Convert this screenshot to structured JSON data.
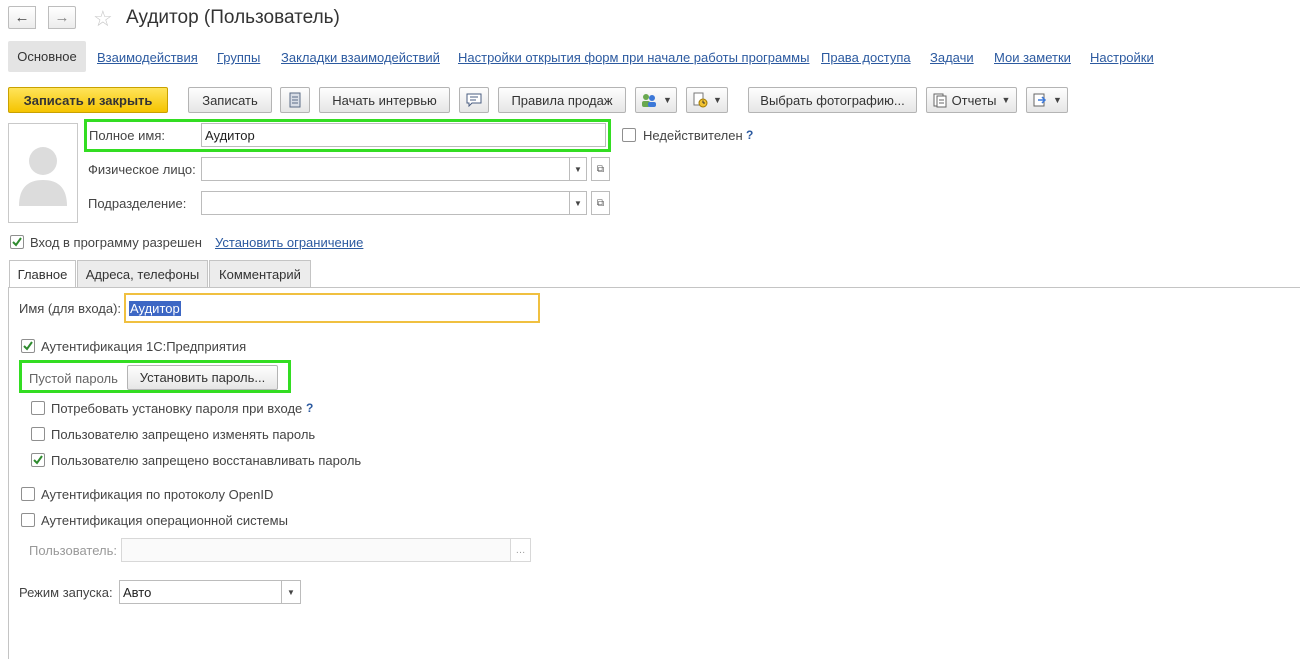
{
  "window": {
    "title": "Аудитор (Пользователь)"
  },
  "nav": {
    "current": "Основное",
    "links": [
      "Взаимодействия",
      "Группы",
      "Закладки взаимодействий",
      "Настройки открытия форм при начале работы программы",
      "Права доступа",
      "Задачи",
      "Мои заметки",
      "Настройки"
    ]
  },
  "toolbar": {
    "save_close": "Записать и закрыть",
    "save": "Записать",
    "start_interview": "Начать интервью",
    "sales_rules": "Правила продаж",
    "choose_photo": "Выбрать фотографию...",
    "reports": "Отчеты"
  },
  "form": {
    "full_name_label": "Полное имя:",
    "full_name_value": "Аудитор",
    "individual_label": "Физическое лицо:",
    "individual_value": "",
    "department_label": "Подразделение:",
    "department_value": "",
    "invalid_label": "Недействителен",
    "hint_mark": "?",
    "login_allowed_label": "Вход в программу разрешен",
    "login_allowed": true,
    "set_restriction_link": "Установить ограничение"
  },
  "tabs": [
    "Главное",
    "Адреса, телефоны",
    "Комментарий"
  ],
  "main_tab": {
    "login_name_label": "Имя (для входа):",
    "login_name_value": "Аудитор",
    "auth_1c_label": "Аутентификация 1С:Предприятия",
    "auth_1c": true,
    "empty_password_label": "Пустой пароль",
    "set_password_button": "Установить пароль...",
    "require_password_label": "Потребовать установку пароля при входе",
    "require_password": false,
    "forbid_change_label": "Пользователю запрещено изменять пароль",
    "forbid_change": false,
    "forbid_restore_label": "Пользователю запрещено восстанавливать пароль",
    "forbid_restore": true,
    "auth_openid_label": "Аутентификация по протоколу OpenID",
    "auth_openid": false,
    "auth_os_label": "Аутентификация операционной системы",
    "auth_os": false,
    "os_user_label": "Пользователь:",
    "os_user_value": "",
    "launch_mode_label": "Режим запуска:",
    "launch_mode_value": "Авто"
  },
  "colors": {
    "link": "#2c5aa0",
    "primary_button": "#f5c400",
    "highlight_green": "#33dd22",
    "focus_yellow": "#f0c040",
    "selection": "#3d67c4"
  }
}
